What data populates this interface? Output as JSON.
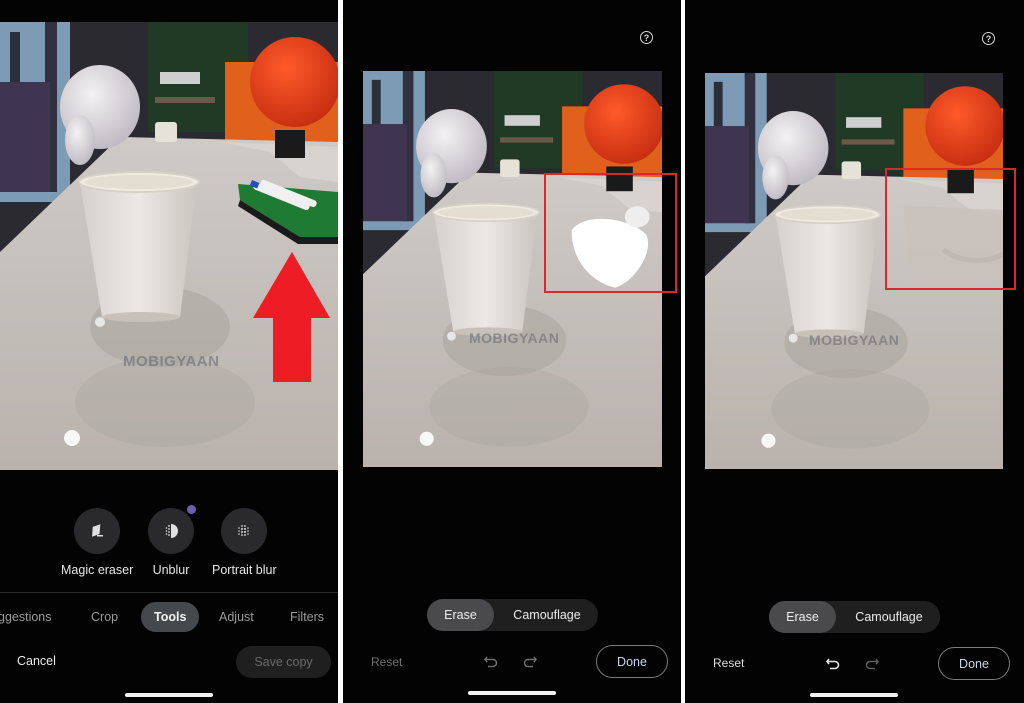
{
  "colors": {
    "background": "#030303",
    "annotation_red": "#e0252c",
    "active_chip": "#45484c",
    "done_text": "#c8d6ee",
    "badge_dot": "#6b5fb0"
  },
  "watermark": "MOBIGYAAN",
  "panel1": {
    "photo_alt": "Photo of a paper cup on a white table with a marker holder at right",
    "annotation": "red-arrow-up",
    "tools": [
      {
        "label": "Magic eraser",
        "icon": "eraser-icon"
      },
      {
        "label": "Unblur",
        "icon": "unblur-icon",
        "badge": true
      },
      {
        "label": "Portrait blur",
        "icon": "portrait-blur-icon"
      }
    ],
    "tabs": [
      {
        "label": "Suggestions",
        "visible_text": "ggestions",
        "active": false
      },
      {
        "label": "Crop",
        "active": false
      },
      {
        "label": "Tools",
        "active": true
      },
      {
        "label": "Adjust",
        "active": false
      },
      {
        "label": "Filters",
        "active": false
      }
    ],
    "cancel_label": "Cancel",
    "save_label": "Save copy"
  },
  "panel2": {
    "photo_alt": "Photo with marker holder being brushed over for erasing",
    "help_icon": "help-circle-icon",
    "modes": [
      "Erase",
      "Camouflage"
    ],
    "active_mode": "Erase",
    "reset_label": "Reset",
    "reset_enabled": false,
    "undo_enabled": false,
    "redo_enabled": false,
    "done_label": "Done"
  },
  "panel3": {
    "photo_alt": "Photo with marker holder erased from the table",
    "help_icon": "help-circle-icon",
    "modes": [
      "Erase",
      "Camouflage"
    ],
    "active_mode": "Erase",
    "reset_label": "Reset",
    "reset_enabled": true,
    "undo_enabled": true,
    "redo_enabled": false,
    "done_label": "Done"
  }
}
